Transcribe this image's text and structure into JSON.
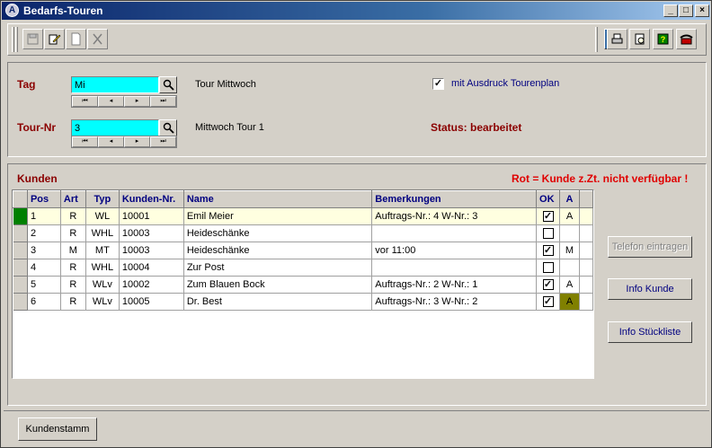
{
  "window": {
    "title": "Bedarfs-Touren"
  },
  "header": {
    "tag_label": "Tag",
    "tag_value": "Mi",
    "tag_desc": "Tour Mittwoch",
    "tour_label": "Tour-Nr",
    "tour_value": "3",
    "tour_desc": "Mittwoch Tour 1",
    "print_checkbox_label": "mit Ausdruck Tourenplan",
    "print_checked": true,
    "status": "Status: bearbeitet"
  },
  "navigator": {
    "first": "⏮",
    "prev": "◂",
    "next": "▸",
    "last": "⏭"
  },
  "customers": {
    "section_label": "Kunden",
    "legend": "Rot = Kunde z.Zt. nicht verfügbar !",
    "columns": [
      "Pos",
      "Art",
      "Typ",
      "Kunden-Nr.",
      "Name",
      "Bemerkungen",
      "OK",
      "A"
    ],
    "rows": [
      {
        "pos": "1",
        "art": "R",
        "typ": "WL",
        "nr": "10001",
        "name": "Emil Meier",
        "bem": "Auftrags-Nr.: 4 W-Nr.: 3",
        "ok": "✓",
        "a": "A"
      },
      {
        "pos": "2",
        "art": "R",
        "typ": "WHL",
        "nr": "10003",
        "name": "Heideschänke",
        "bem": "",
        "ok": "",
        "a": ""
      },
      {
        "pos": "3",
        "art": "M",
        "typ": "MT",
        "nr": "10003",
        "name": "Heideschänke",
        "bem": "vor 11:00",
        "ok": "✓",
        "a": "M"
      },
      {
        "pos": "4",
        "art": "R",
        "typ": "WHL",
        "nr": "10004",
        "name": "Zur Post",
        "bem": "",
        "ok": "",
        "a": ""
      },
      {
        "pos": "5",
        "art": "R",
        "typ": "WLv",
        "nr": "10002",
        "name": "Zum Blauen Bock",
        "bem": "Auftrags-Nr.: 2 W-Nr.: 1",
        "ok": "✓",
        "a": "A"
      },
      {
        "pos": "6",
        "art": "R",
        "typ": "WLv",
        "nr": "10005",
        "name": "Dr. Best",
        "bem": "Auftrags-Nr.: 3 W-Nr.: 2",
        "ok": "✓",
        "a": "A"
      }
    ]
  },
  "buttons": {
    "telefon": "Telefon eintragen",
    "info_kunde": "Info Kunde",
    "info_stueckliste": "Info Stückliste",
    "kundenstamm": "Kundenstamm"
  },
  "titlebar_buttons": {
    "min": "_",
    "max": "□",
    "close": "×"
  },
  "colors": {
    "lookup_bg": "#00ffff",
    "label_red": "#8b0000",
    "legend_red": "#e00000",
    "selected_indicator": "#008000",
    "olive": "#808000"
  }
}
